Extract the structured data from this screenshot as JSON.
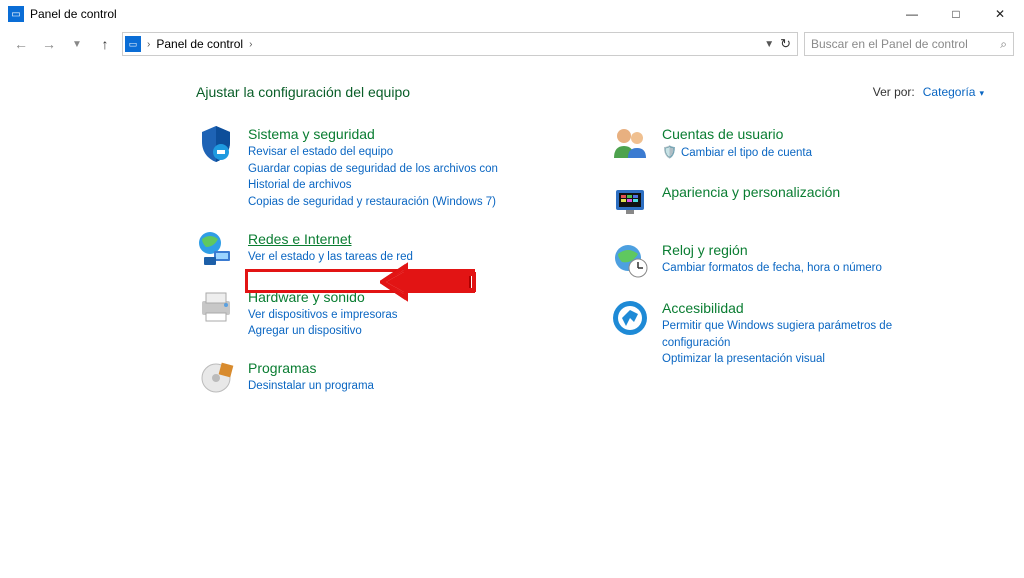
{
  "window": {
    "title": "Panel de control"
  },
  "address": {
    "root": "Panel de control"
  },
  "search": {
    "placeholder": "Buscar en el Panel de control"
  },
  "page": {
    "heading": "Ajustar la configuración del equipo",
    "viewby_label": "Ver por:",
    "viewby_value": "Categoría"
  },
  "left": [
    {
      "title": "Sistema y seguridad",
      "links": [
        "Revisar el estado del equipo",
        "Guardar copias de seguridad de los archivos con Historial de archivos",
        "Copias de seguridad y restauración (Windows 7)"
      ]
    },
    {
      "title": "Redes e Internet",
      "links": [
        "Ver el estado y las tareas de red"
      ]
    },
    {
      "title": "Hardware y sonido",
      "links": [
        "Ver dispositivos e impresoras",
        "Agregar un dispositivo"
      ]
    },
    {
      "title": "Programas",
      "links": [
        "Desinstalar un programa"
      ]
    }
  ],
  "right": [
    {
      "title": "Cuentas de usuario",
      "links": [
        "Cambiar el tipo de cuenta"
      ],
      "shield_on_first": true
    },
    {
      "title": "Apariencia y personalización",
      "links": []
    },
    {
      "title": "Reloj y región",
      "links": [
        "Cambiar formatos de fecha, hora o número"
      ]
    },
    {
      "title": "Accesibilidad",
      "links": [
        "Permitir que Windows sugiera parámetros de configuración",
        "Optimizar la presentación visual"
      ]
    }
  ]
}
